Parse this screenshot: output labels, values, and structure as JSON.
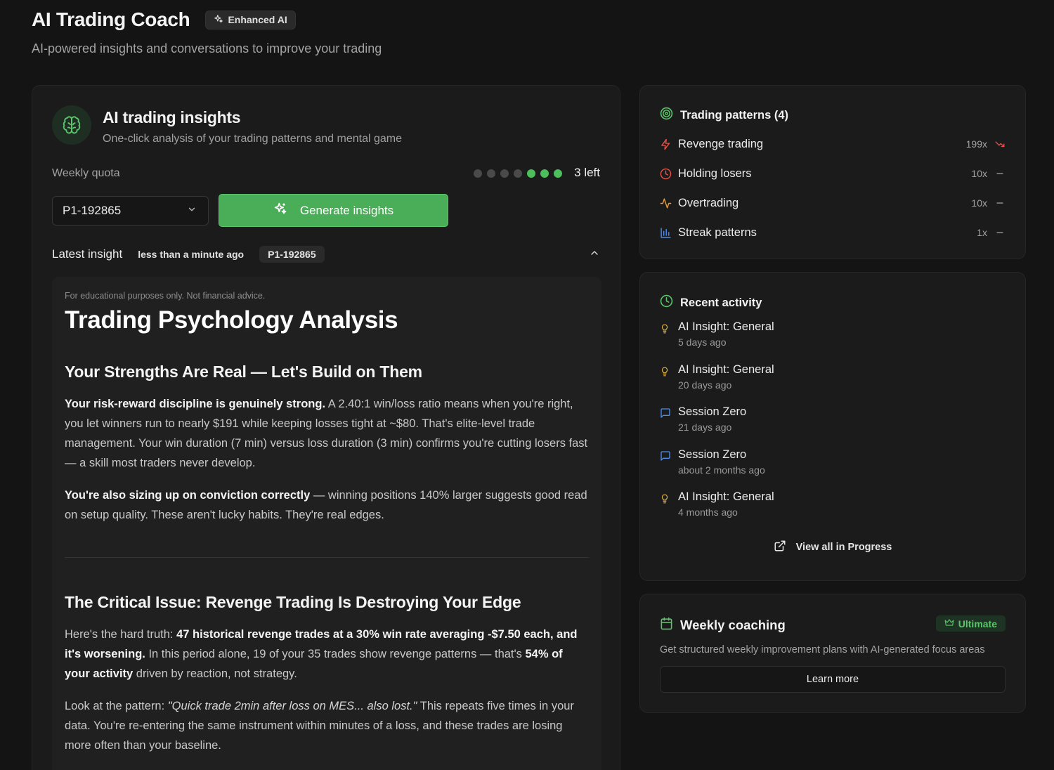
{
  "header": {
    "title": "AI Trading Coach",
    "badge": "Enhanced AI",
    "subtitle": "AI-powered insights and conversations to improve your trading"
  },
  "insights": {
    "title": "AI trading insights",
    "subtitle": "One-click analysis of your trading patterns and mental game",
    "quota_label": "Weekly quota",
    "quota_used": 4,
    "quota_total": 7,
    "quota_left": "3 left",
    "account_select": "P1-192865",
    "generate_label": "Generate insights",
    "latest_label": "Latest insight",
    "latest_time": "less than a minute ago",
    "latest_tag": "P1-192865"
  },
  "analysis": {
    "disclaimer": "For educational purposes only. Not financial advice.",
    "heading": "Trading Psychology Analysis",
    "section1_title": "Your Strengths Are Real — Let's Build on Them",
    "p1_bold": "Your risk-reward discipline is genuinely strong.",
    "p1_text": " A 2.40:1 win/loss ratio means when you're right, you let winners run to nearly $191 while keeping losses tight at ~$80. That's elite-level trade management. Your win duration (7 min) versus loss duration (3 min) confirms you're cutting losers fast — a skill most traders never develop.",
    "p2_bold": "You're also sizing up on conviction correctly",
    "p2_text": " — winning positions 140% larger suggests good read on setup quality. These aren't lucky habits. They're real edges.",
    "section2_title": "The Critical Issue: Revenge Trading Is Destroying Your Edge",
    "p3_a": "Here's the hard truth: ",
    "p3_bold1": "47 historical revenge trades at a 30% win rate averaging -$7.50 each, and it's worsening.",
    "p3_b": " In this period alone, 19 of your 35 trades show revenge patterns — that's ",
    "p3_bold2": "54% of your activity",
    "p3_c": " driven by reaction, not strategy.",
    "p4_a": "Look at the pattern: ",
    "p4_italic": "\"Quick trade 2min after loss on MES... also lost.\"",
    "p4_b": " This repeats five times in your data. You're re-entering the same instrument within minutes of a loss, and these trades are losing more often than your baseline."
  },
  "patterns": {
    "title": "Trading patterns (4)",
    "items": [
      {
        "name": "Revenge trading",
        "count": "199x",
        "trend": "down",
        "icon": "zap-icon",
        "color": "#e5534b"
      },
      {
        "name": "Holding losers",
        "count": "10x",
        "trend": "flat",
        "icon": "clock-icon",
        "color": "#e5534b"
      },
      {
        "name": "Overtrading",
        "count": "10x",
        "trend": "flat",
        "icon": "activity-icon",
        "color": "#e59b3b"
      },
      {
        "name": "Streak patterns",
        "count": "1x",
        "trend": "flat",
        "icon": "bar-chart-icon",
        "color": "#4d8ef0"
      }
    ]
  },
  "activity": {
    "title": "Recent activity",
    "items": [
      {
        "title": "AI Insight: General",
        "time": "5 days ago",
        "icon": "lightbulb-icon"
      },
      {
        "title": "AI Insight: General",
        "time": "20 days ago",
        "icon": "lightbulb-icon"
      },
      {
        "title": "Session Zero",
        "time": "21 days ago",
        "icon": "chat-icon"
      },
      {
        "title": "Session Zero",
        "time": "about 2 months ago",
        "icon": "chat-icon"
      },
      {
        "title": "AI Insight: General",
        "time": "4 months ago",
        "icon": "lightbulb-icon"
      }
    ],
    "view_all": "View all in Progress"
  },
  "coaching": {
    "title": "Weekly coaching",
    "badge": "Ultimate",
    "description": "Get structured weekly improvement plans with AI-generated focus areas",
    "learn_more": "Learn more"
  },
  "colors": {
    "accent_green": "#4aad57",
    "danger_red": "#e5534b",
    "warning_orange": "#e59b3b",
    "info_blue": "#4d8ef0",
    "lightbulb_yellow": "#e0b341"
  }
}
